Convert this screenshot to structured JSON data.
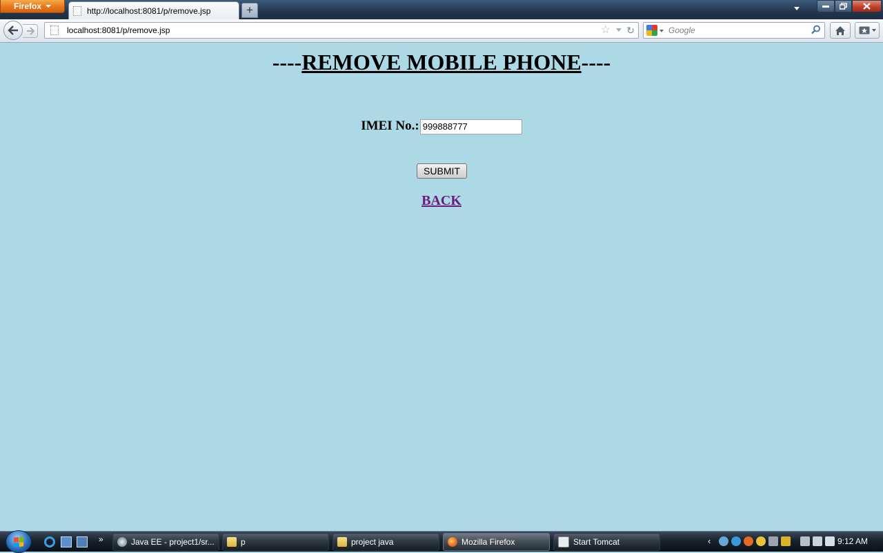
{
  "browser": {
    "menu_button_label": "Firefox",
    "tab_title": "http://localhost:8081/p/remove.jsp",
    "new_tab_symbol": "+",
    "url": "localhost:8081/p/remove.jsp",
    "search_placeholder": "Google"
  },
  "page": {
    "title_prefix": "----",
    "title": "REMOVE MOBILE PHONE",
    "title_suffix": "----",
    "imei_label": "IMEI No.:",
    "imei_value": "999888777",
    "submit_label": "SUBMIT",
    "back_link_label": "BACK",
    "background_color": "#add8e6",
    "link_color": "#6b1b7a"
  },
  "taskbar": {
    "items": [
      {
        "label": "Java EE - project1/sr...",
        "icon": "eclipse-icon"
      },
      {
        "label": "p",
        "icon": "folder-icon"
      },
      {
        "label": "project java",
        "icon": "folder-icon"
      },
      {
        "label": "Mozilla Firefox",
        "icon": "firefox-icon",
        "active": true
      },
      {
        "label": "Start Tomcat",
        "icon": "console-icon"
      }
    ],
    "clock": "9:12 AM"
  }
}
